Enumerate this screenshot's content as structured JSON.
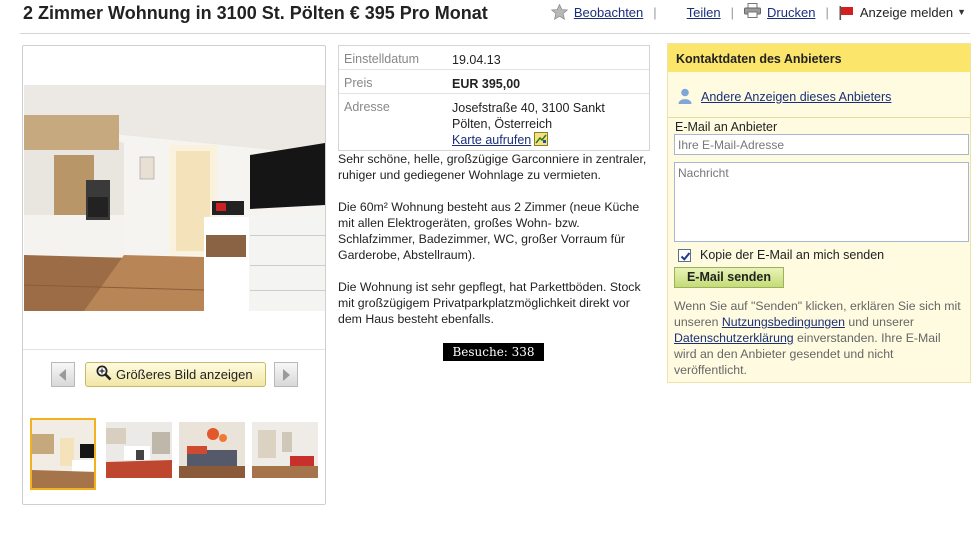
{
  "listing": {
    "title": "2 Zimmer Wohnung in 3100 St. Pölten € 395 Pro Monat"
  },
  "actions": {
    "watch": "Beobachten",
    "share": "Teilen",
    "print": "Drucken",
    "report": "Anzeige melden"
  },
  "gallery": {
    "bigger_image": "Größeres Bild anzeigen",
    "thumbnail_count": 4,
    "selected_index": 0
  },
  "details": {
    "date_label": "Einstelldatum",
    "date_value": "19.04.13",
    "price_label": "Preis",
    "price_value": "EUR 395,00",
    "address_label": "Adresse",
    "address_line1": "Josefstraße 40, 3100 Sankt",
    "address_line2": "Pölten, Österreich",
    "map_link": "Karte aufrufen"
  },
  "description": {
    "p1": "Sehr schöne, helle, großzügige Garconniere in zentraler, ruhiger und gediegener Wohnlage zu vermieten.",
    "p2": "Die 60m² Wohnung besteht aus 2 Zimmer (neue Küche mit allen Elektrogeräten, großes Wohn- bzw. Schlafzimmer, Badezimmer, WC, großer Vorraum für Garderobe, Abstellraum).",
    "p3": "Die Wohnung ist sehr gepflegt, hat Parkettböden. Stock mit großzügigem Privatparkplatzmöglichkeit direkt vor dem Haus besteht ebenfalls."
  },
  "visits": "Besuche: 338",
  "contact": {
    "heading": "Kontaktdaten des Anbieters",
    "other_ads": "Andere Anzeigen dieses Anbieters",
    "email_label": "E-Mail an Anbieter",
    "email_placeholder": "Ihre E-Mail-Adresse",
    "message_placeholder": "Nachricht",
    "copy_label": "Kopie der E-Mail an mich senden",
    "copy_checked": true,
    "send_button": "E-Mail senden",
    "legal_pre": "Wenn Sie auf \"Senden\" klicken, erklären Sie sich mit unseren ",
    "terms_link": "Nutzungsbedingungen",
    "legal_mid": " und unserer ",
    "privacy_link": "Datenschutzerklärung",
    "legal_post": " einverstanden. Ihre E-Mail wird an den Anbieter gesendet und nicht veröffentlicht."
  },
  "colors": {
    "link": "#1a2f7a",
    "contact_header": "#fbe66b",
    "contact_bg": "#fffbe0",
    "thumb_selected": "#f3b21d",
    "send_button": "#c4dc76"
  }
}
